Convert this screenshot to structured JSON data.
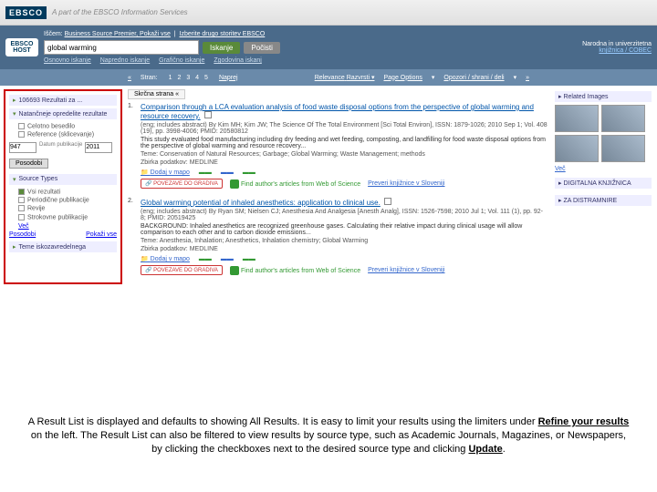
{
  "banner": {
    "logo": "EBSCO",
    "sub": "A part of the EBSCO Information Services"
  },
  "search": {
    "db_label": "Iščem:",
    "db_name": "Business Source Premier, Pokaži vse",
    "opt": "Izberite drugo storitev EBSCO",
    "value": "global warming",
    "btn_search": "Iskanje",
    "btn_clear": "Počisti",
    "links": [
      "Osnovno iskanje",
      "Napredno iskanje",
      "Grafično iskanje",
      "Zgodovina iskanj"
    ],
    "inst1": "Narodna in univerzitetna",
    "inst2": "knjižnica / COBEC"
  },
  "toolbar": {
    "pages_label": "Stran:",
    "pages": [
      "1",
      "2",
      "3",
      "4",
      "5"
    ],
    "next": "Naprej",
    "rel": "Relevance",
    "sort": "Razvrsti",
    "opts": "Page Options",
    "share": "Opozori / shrani / deli"
  },
  "facets": {
    "results_count": "106693 Rezultati za ...",
    "refine": "Natančneje opredelite rezultate",
    "full_text": "Celotno besedilo",
    "references": "Reference (sklicevanje)",
    "from": "947",
    "to": "2011",
    "from_label": "Datum publikacije",
    "update": "Posodobi",
    "source_types": "Source Types",
    "all": "Vsi rezultati",
    "types": [
      "Periodične publikacije",
      "Revije",
      "Strokovne publikacije"
    ],
    "more": "Več",
    "show_all": "Pokaži vse",
    "thesaurus": "Teme iskozavredelnega"
  },
  "results": [
    {
      "num": "1.",
      "title": "Comparison through a LCA evaluation analysis of food waste disposal options from the perspective of global warming and resource recovery.",
      "meta": "(eng; includes abstract) By Kim MH; Kim JW; The Science Of The Total Environment [Sci Total Environ], ISSN: 1879-1026; 2010 Sep 1; Vol. 408 (19), pp. 3998-4006; PMID: 20580812",
      "abs": "This study evaluated food manufacturing including dry feeding and wet feeding, composting, and landfilling for food waste disposal options from the perspective of global warming and resource recovery...",
      "terms": "Teme: Conservation of Natural Resources; Garbage; Global Warming; Waste Management; methods",
      "db": "Zbirka podatkov: MEDLINE",
      "add": "Dodaj v mapo"
    },
    {
      "num": "2.",
      "title": "Global warming potential of inhaled anesthetics: application to clinical use.",
      "meta": "(eng; includes abstract) By Ryan SM; Nielsen CJ; Anesthesia And Analgesia [Anesth Analg], ISSN: 1526-7598; 2010 Jul 1; Vol. 111 (1), pp. 92-8; PMID: 20519425",
      "abs": "BACKGROUND: Inhaled anesthetics are recognized greenhouse gases. Calculating their relative impact during clinical usage will allow comparison to each other and to carbon dioxide emissions...",
      "terms": "Teme: Anesthesia, Inhalation; Anesthetics, Inhalation chemistry; Global Warming",
      "db": "Zbirka podatkov: MEDLINE",
      "add": "Dodaj v mapo"
    }
  ],
  "res_common": {
    "povezave": "POVEZAVE DO GRADIVA",
    "wos": "Find author's articles from Web of Science",
    "slov": "Preveri knjižnice v Sloveniji"
  },
  "right": {
    "related": "Related Images",
    "more": "Več",
    "dig": "DIGITALNA KNJIŽNICA",
    "ask": "ZA DISTRAMNIRE"
  },
  "caption": "A Result List is displayed and defaults to showing All Results. It is easy to limit your results using the limiters under Refine your results on the left. The Result List can also be filtered to view results by source type, such as Academic Journals, Magazines, or Newspapers, by clicking the checkboxes next to the desired source type and clicking Update."
}
